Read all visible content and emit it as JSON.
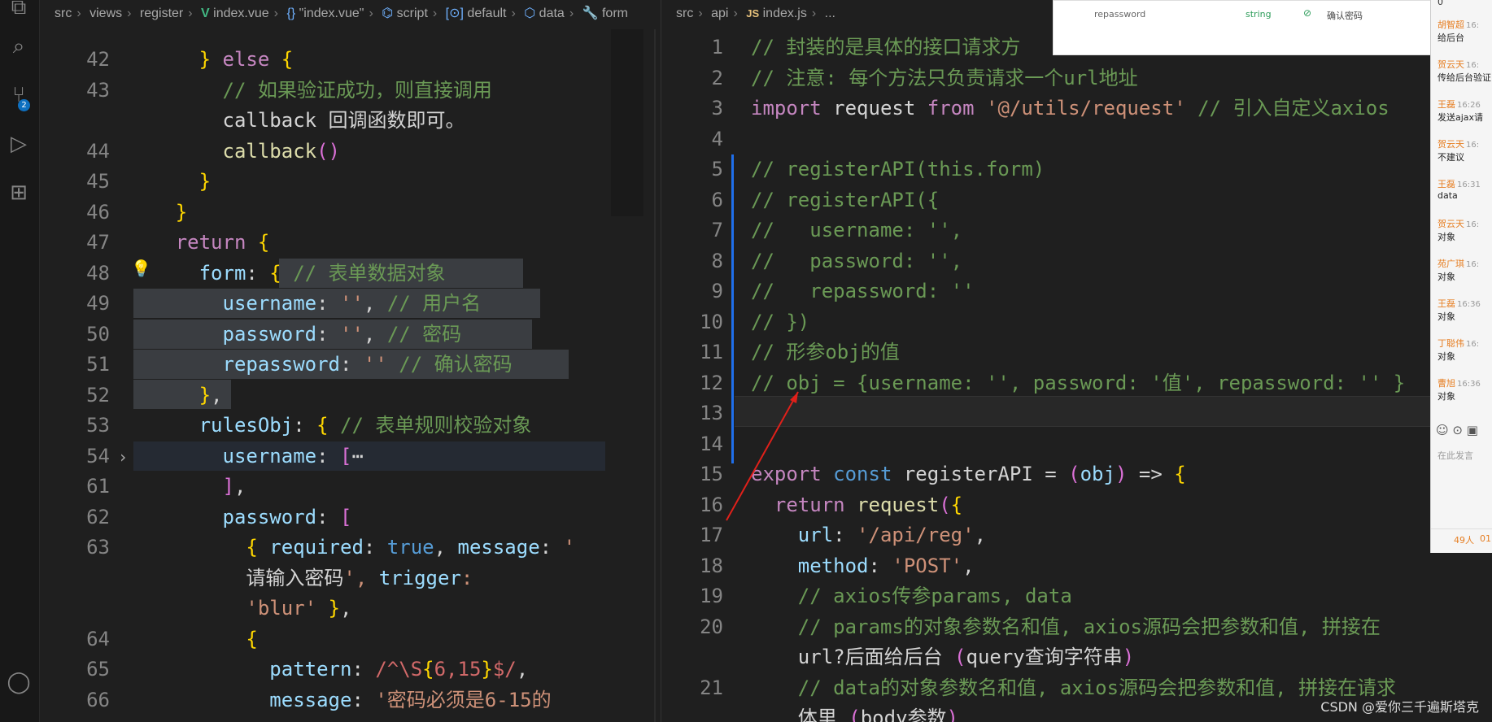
{
  "left_breadcrumb": [
    "src",
    "views",
    "register",
    "index.vue",
    "\"index.vue\"",
    "script",
    "default",
    "data",
    "form"
  ],
  "right_breadcrumb": [
    "src",
    "api",
    "index.js",
    "..."
  ],
  "scm_badge": "2",
  "left_lines": [
    {
      "n": "42",
      "t": "        } else {"
    },
    {
      "n": "43",
      "t": "          // 如果验证成功，则直接调用"
    },
    {
      "n": "",
      "t": "          callback 回调函数即可。"
    },
    {
      "n": "44",
      "t": "          callback()"
    },
    {
      "n": "45",
      "t": "        }"
    },
    {
      "n": "46",
      "t": "      }"
    },
    {
      "n": "47",
      "t": "      return {"
    },
    {
      "n": "48",
      "t": "        form: { // 表单数据对象"
    },
    {
      "n": "49",
      "t": "          username: '', // 用户名"
    },
    {
      "n": "50",
      "t": "          password: '', // 密码"
    },
    {
      "n": "51",
      "t": "          repassword: '' // 确认密码"
    },
    {
      "n": "52",
      "t": "        },"
    },
    {
      "n": "53",
      "t": "        rulesObj: { // 表单规则校验对象"
    },
    {
      "n": "54",
      "t": "          username: [⋯"
    },
    {
      "n": "61",
      "t": "          ],"
    },
    {
      "n": "62",
      "t": "          password: ["
    },
    {
      "n": "63",
      "t": "            { required: true, message: '"
    },
    {
      "n": "",
      "t": "            请输入密码', trigger:"
    },
    {
      "n": "",
      "t": "            'blur' },"
    },
    {
      "n": "64",
      "t": "            {"
    },
    {
      "n": "65",
      "t": "              pattern: /^\\S{6,15}$/,"
    },
    {
      "n": "66",
      "t": "              message: '密码必须是6-15的"
    }
  ],
  "right_lines": [
    {
      "n": "1",
      "t": "// 封装的是具体的接口请求方"
    },
    {
      "n": "2",
      "t": "// 注意: 每个方法只负责请求一个url地址"
    },
    {
      "n": "3",
      "t": "import request from '@/utils/request' // 引入自定义axios"
    },
    {
      "n": "4",
      "t": ""
    },
    {
      "n": "5",
      "t": "// registerAPI(this.form)"
    },
    {
      "n": "6",
      "t": "// registerAPI({"
    },
    {
      "n": "7",
      "t": "//   username: '',"
    },
    {
      "n": "8",
      "t": "//   password: '',"
    },
    {
      "n": "9",
      "t": "//   repassword: ''"
    },
    {
      "n": "10",
      "t": "// })"
    },
    {
      "n": "11",
      "t": "// 形参obj的值"
    },
    {
      "n": "12",
      "t": "// obj = {username: '', password: '值', repassword: '' }"
    },
    {
      "n": "13",
      "t": ""
    },
    {
      "n": "14",
      "t": ""
    },
    {
      "n": "15",
      "t": "export const registerAPI = (obj) => {"
    },
    {
      "n": "16",
      "t": "  return request({"
    },
    {
      "n": "17",
      "t": "    url: '/api/reg',"
    },
    {
      "n": "18",
      "t": "    method: 'POST',"
    },
    {
      "n": "19",
      "t": "    // axios传参params, data"
    },
    {
      "n": "20",
      "t": "    // params的对象参数名和值, axios源码会把参数和值, 拼接在"
    },
    {
      "n": "",
      "t": "    url?后面给后台 (query查询字符串)"
    },
    {
      "n": "21",
      "t": "    // data的对象参数名和值, axios源码会把参数和值, 拼接在请求"
    },
    {
      "n": "",
      "t": "    体里 (body参数)"
    }
  ],
  "popup": {
    "field": "repassword",
    "type": "string",
    "desc": "确认密码"
  },
  "chat": {
    "top": "0",
    "messages": [
      {
        "name": "胡智超",
        "time": "16:",
        "msg": "给后台"
      },
      {
        "name": "贺云天",
        "time": "16:",
        "msg": "传给后台验证"
      },
      {
        "name": "王磊",
        "time": "16:26",
        "msg": "发送ajax请"
      },
      {
        "name": "贺云天",
        "time": "16:",
        "msg": "不建议"
      },
      {
        "name": "王磊",
        "time": "16:31",
        "msg": "data"
      },
      {
        "name": "贺云天",
        "time": "16:",
        "msg": "对象"
      },
      {
        "name": "苑广琪",
        "time": "16:",
        "msg": "对象"
      },
      {
        "name": "王磊",
        "time": "16:36",
        "msg": "对象"
      },
      {
        "name": "丁聪伟",
        "time": "16:",
        "msg": "对象"
      },
      {
        "name": "曹旭",
        "time": "16:36",
        "msg": "对象"
      }
    ],
    "input_placeholder": "在此发言",
    "count": "49人",
    "count_suffix": "01"
  },
  "watermark": "CSDN @爱你三千遍斯塔克"
}
